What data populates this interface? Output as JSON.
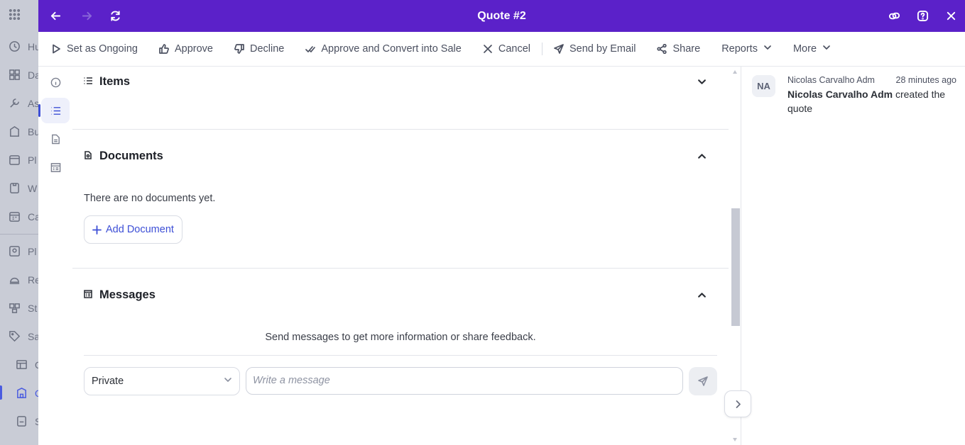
{
  "background_sidebar": {
    "items": [
      {
        "label": "Hu",
        "icon": "clock-icon"
      },
      {
        "label": "Da",
        "icon": "dashboard-icon"
      },
      {
        "label": "As",
        "icon": "tool-icon"
      },
      {
        "label": "Bu",
        "icon": "building-icon"
      },
      {
        "label": "Pl",
        "icon": "calendar-icon"
      },
      {
        "label": "W",
        "icon": "clipboard-icon"
      },
      {
        "label": "Ca",
        "icon": "calendar-grid-icon"
      },
      {
        "label": "Pl",
        "icon": "planner-icon"
      },
      {
        "label": "Re",
        "icon": "bell-icon"
      },
      {
        "label": "St",
        "icon": "stock-icon"
      },
      {
        "label": "Sa",
        "icon": "tag-icon"
      },
      {
        "label": "Q",
        "icon": "table-icon"
      },
      {
        "label": "Q",
        "icon": "quote-icon"
      },
      {
        "label": "S",
        "icon": "sales-icon"
      }
    ]
  },
  "titlebar": {
    "title": "Quote #2",
    "back_icon": "arrow-left-icon",
    "forward_icon": "arrow-right-icon",
    "refresh_icon": "refresh-icon",
    "link_icon": "link-icon",
    "help_icon": "help-icon",
    "close_icon": "close-icon"
  },
  "toolbar": {
    "set_ongoing": "Set as Ongoing",
    "approve": "Approve",
    "decline": "Decline",
    "approve_convert": "Approve and Convert into Sale",
    "cancel": "Cancel",
    "send_email": "Send by Email",
    "share": "Share",
    "reports": "Reports",
    "more": "More"
  },
  "sections": {
    "items": {
      "title": "Items"
    },
    "documents": {
      "title": "Documents",
      "empty_text": "There are no documents yet.",
      "add_label": "Add Document"
    },
    "messages": {
      "title": "Messages",
      "hint": "Send messages to get more information or share feedback.",
      "visibility_value": "Private",
      "placeholder": "Write a message"
    }
  },
  "activity": {
    "avatar_initials": "NA",
    "author": "Nicolas Carvalho Adm",
    "time": "28 minutes ago",
    "actor": "Nicolas Carvalho Adm",
    "action": " created the quote"
  },
  "colors": {
    "titlebar_bg": "#5b21c9",
    "accent": "#3d4fd6"
  }
}
